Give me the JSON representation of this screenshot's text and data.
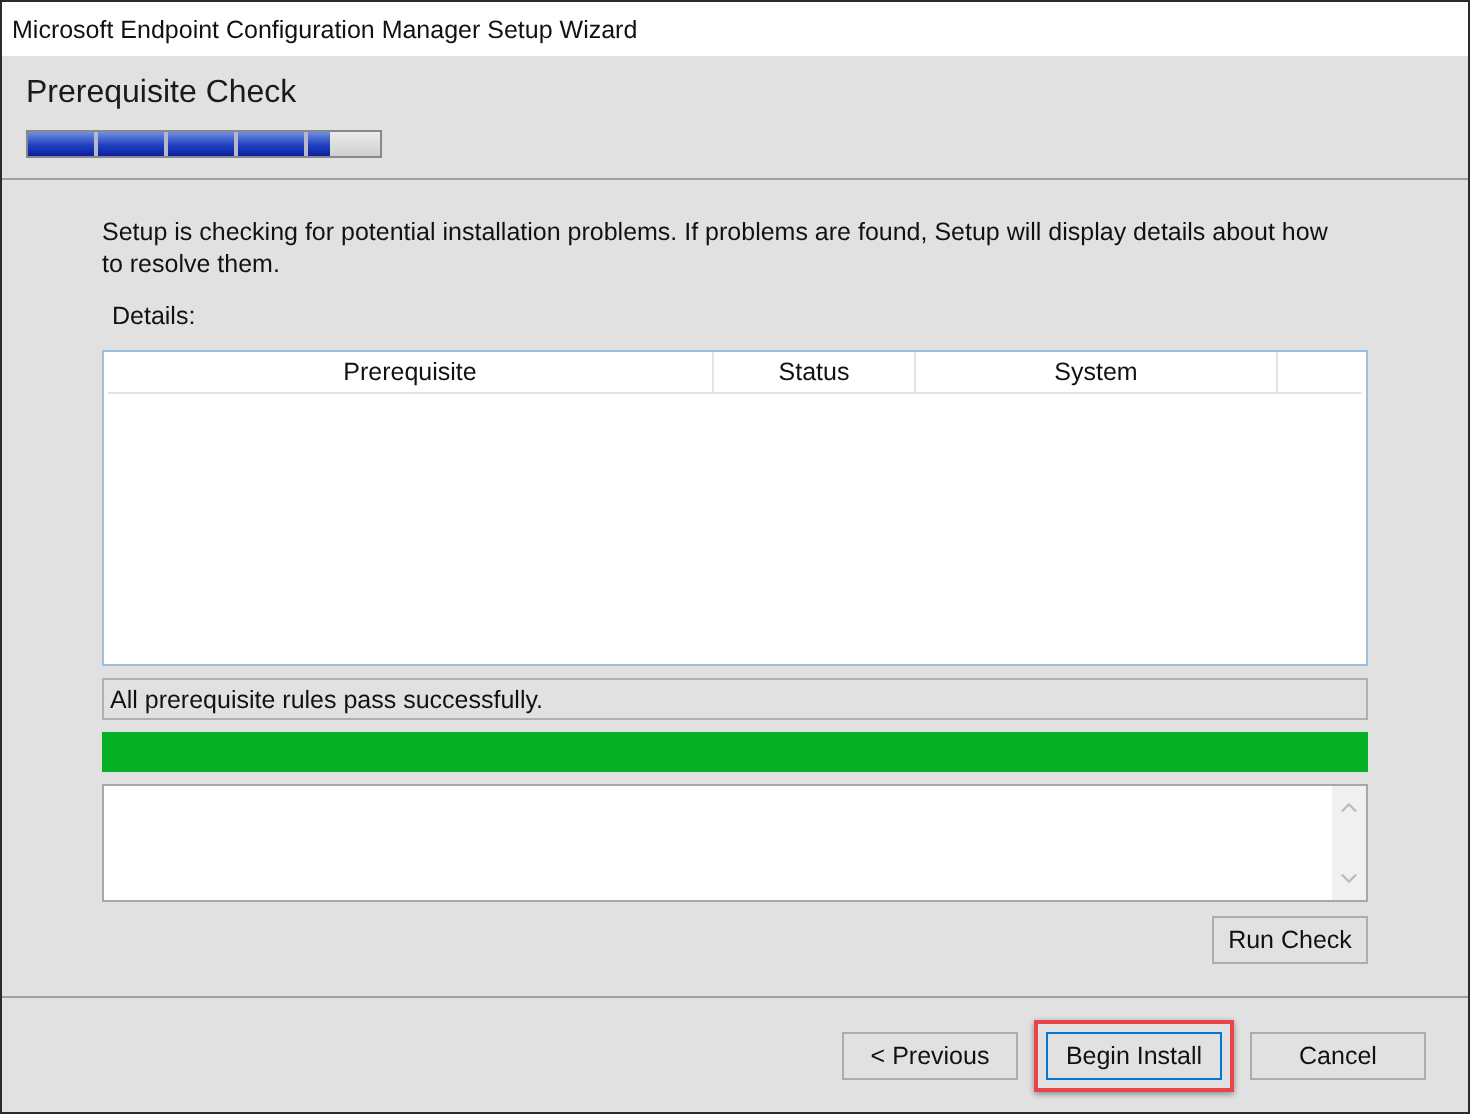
{
  "window": {
    "title": "Microsoft Endpoint Configuration Manager Setup Wizard"
  },
  "header": {
    "title": "Prerequisite Check",
    "wizard_progress": {
      "level": 0.86
    }
  },
  "intro": "Setup is checking for potential installation problems. If problems are found, Setup will display details about how to resolve them.",
  "details": {
    "label": "Details:",
    "columns": [
      "Prerequisite",
      "Status",
      "System"
    ]
  },
  "result": {
    "message": "All prerequisite rules pass successfully.",
    "level": 1
  },
  "run_check_button": "Run Check",
  "buttons": [
    {
      "label": "< Previous",
      "focused": false,
      "highlighted": false
    },
    {
      "label": "Begin Install",
      "focused": true,
      "highlighted": true
    },
    {
      "label": "Cancel",
      "focused": false,
      "highlighted": false
    }
  ]
}
